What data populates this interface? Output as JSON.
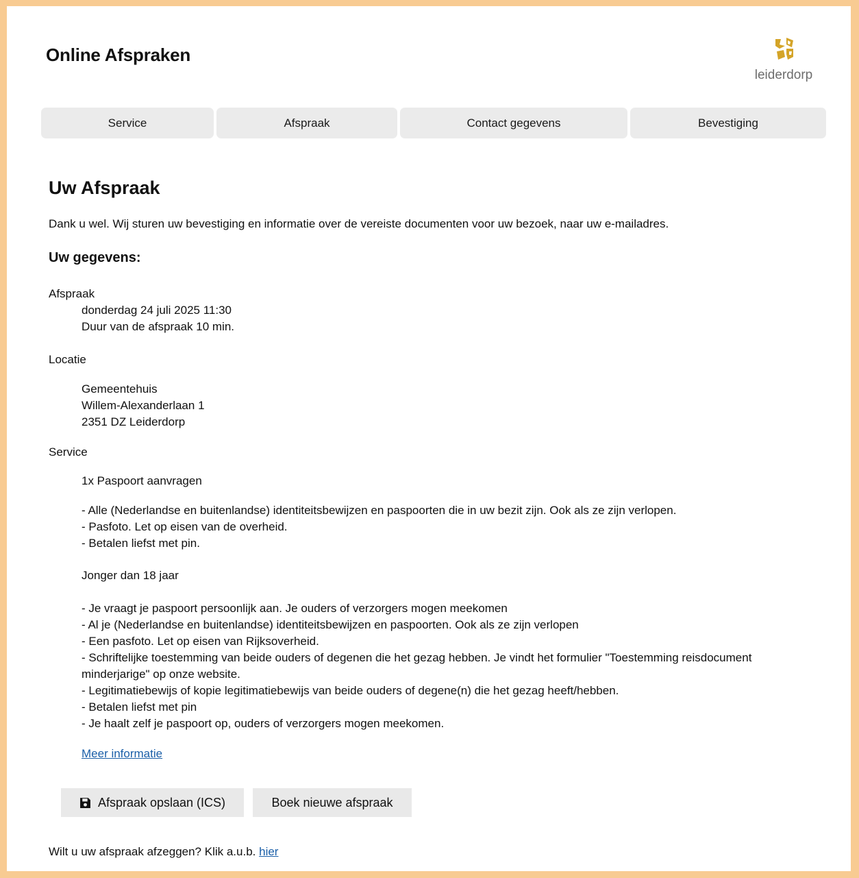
{
  "header": {
    "title": "Online Afspraken",
    "logo_text": "leiderdorp",
    "logo_color": "#d4a428"
  },
  "tabs": [
    "Service",
    "Afspraak",
    "Contact gegevens",
    "Bevestiging"
  ],
  "main": {
    "heading": "Uw Afspraak",
    "intro": "Dank u wel. Wij sturen uw bevestiging en informatie over de vereiste documenten voor uw bezoek, naar uw e-mailadres.",
    "details_heading": "Uw gegevens:",
    "appointment": {
      "label": "Afspraak",
      "datetime": "donderdag 24 juli 2025 11:30",
      "duration": "Duur van de afspraak 10 min."
    },
    "location": {
      "label": "Locatie",
      "name": "Gemeentehuis",
      "street": "Willem-Alexanderlaan 1",
      "city": "2351 DZ Leiderdorp"
    },
    "service": {
      "label": "Service",
      "item": "1x Paspoort aanvragen",
      "requirements": [
        "- Alle (Nederlandse en buitenlandse) identiteitsbewijzen en paspoorten die in uw bezit zijn. Ook als ze zijn verlopen.",
        "- Pasfoto. Let op eisen van de overheid.",
        "- Betalen liefst met pin."
      ],
      "minor_heading": "Jonger dan 18 jaar",
      "minor_requirements": [
        "- Je vraagt je paspoort persoonlijk aan. Je ouders of verzorgers mogen meekomen",
        "- Al je (Nederlandse en buitenlandse) identiteitsbewijzen en paspoorten. Ook als ze zijn verlopen",
        "- Een pasfoto. Let op eisen van Rijksoverheid.",
        "- Schriftelijke toestemming van beide ouders of degenen die het gezag hebben. Je vindt het formulier \"Toestemming reisdocument",
        "minderjarige\" op onze website.",
        "- Legitimatiebewijs of kopie legitimatiebewijs van beide ouders of degene(n) die het gezag heeft/hebben.",
        "- Betalen liefst met pin",
        "- Je haalt zelf je paspoort op, ouders of verzorgers mogen meekomen."
      ],
      "more_info_link": "Meer informatie"
    },
    "buttons": {
      "save_ics": "Afspraak opslaan (ICS)",
      "new_appointment": "Boek nieuwe afspraak"
    },
    "cancel": {
      "text": "Wilt u uw afspraak afzeggen? Klik a.u.b.",
      "link": "hier"
    }
  }
}
